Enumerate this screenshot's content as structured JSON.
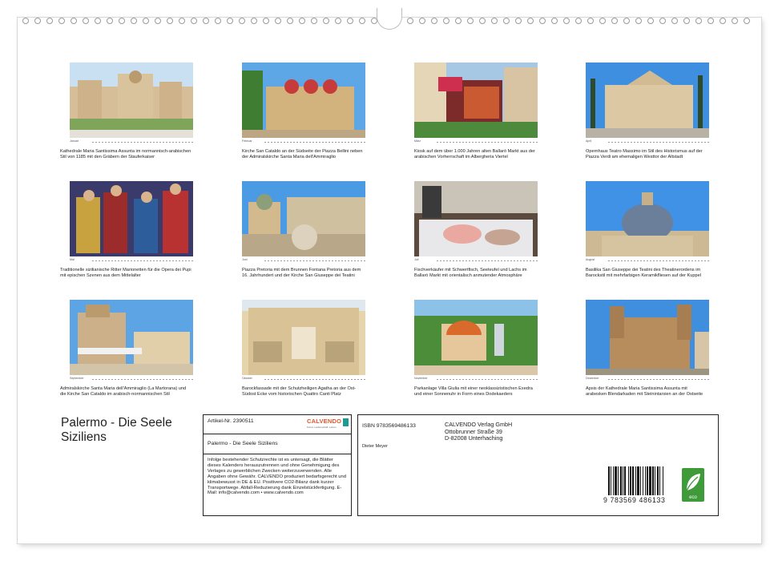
{
  "months": [
    {
      "label": "Januar",
      "caption": "Kathedrale Maria Santissima Assunta im normannisch-arabischen Stil von 1185 mit den Gräbern der Stauferkaiser",
      "scene": "cathedral"
    },
    {
      "label": "Februar",
      "caption": "Kirche San Cataldo an der Südseite der Piazza Bellini neben der Admiralskirche Santa Maria dell'Ammiraglio",
      "scene": "domes"
    },
    {
      "label": "März",
      "caption": "Kiosk auf dem über 1.000 Jahren alten Ballarò Markt aus der arabischen Vorherrschaft im Albergheria Viertel",
      "scene": "kiosk"
    },
    {
      "label": "April",
      "caption": "Opernhaus Teatro Massimo im Stil des Historismus auf der Piazza Verdi am ehemaligen Westtor der Altstadt",
      "scene": "opera"
    },
    {
      "label": "Mai",
      "caption": "Traditionelle sizilianische Ritter Marionetten für die Opera dei Pupi mit epischen Szenen aus dem Mittelalter",
      "scene": "puppets"
    },
    {
      "label": "Juni",
      "caption": "Piazza Pretoria mit dem Brunnen Fontana Pretoria aus dem 16. Jahrhundert und der Kirche San Giuseppe dei Teatini",
      "scene": "fountain"
    },
    {
      "label": "Juli",
      "caption": "Fischverkäufer mit Schwertfisch, Seeteufel und Lachs im Ballarò Markt mit orientalisch anmutender Atmosphäre",
      "scene": "fish"
    },
    {
      "label": "August",
      "caption": "Basilika San Giuseppe dei Teatini des Theatinerordens im Barockstil mit mehrfarbigen Keramikfliesen auf der Kuppel",
      "scene": "basilica"
    },
    {
      "label": "September",
      "caption": "Admiralskirche Santa Maria dell'Ammiraglio (La Martorana) und die Kirche San Cataldo im arabisch-normannischen Stil",
      "scene": "martorana"
    },
    {
      "label": "Oktober",
      "caption": "Barockfassade mit der Schutzheiligen Agatha an der Ost-Südost Ecke vom historischen Quattro Canti Platz",
      "scene": "baroque"
    },
    {
      "label": "November",
      "caption": "Parkanlage Villa Giulia mit einer neoklassizistischen Exedra und einer Sonnenuhr in Form eines Dodekaeders",
      "scene": "park"
    },
    {
      "label": "Dezember",
      "caption": "Apsis der Kathedrale Maria Santissima Assunta mit arabesken Blendarkaden mit Steinintarsien an der Ostseite",
      "scene": "apse"
    }
  ],
  "title_line1": "Palermo - Die Seele",
  "title_line2": "Siziliens",
  "article": "Artikel-Nr. 2390511",
  "calvendo_logo": "CALVENDO",
  "calvendo_tag": "Kunst. Leidenschaft. Leben.",
  "product_title": "Palermo - Die Seele Siziliens",
  "legal": "Infolge bestehender Schutzrechte ist es untersagt, die Blätter dieses Kalenders herauszutrennen und ohne Genehmigung des Verlages zu gewerblichen Zwecken weiterzuverwenden. Alle Angaben ohne Gewähr. CALVENDO produziert bedarfsgerecht und klimabewusst in DE & EU. Positivere CO2-Bilanz dank kurzer Transportwege. Abfall-Reduzierung dank Einzelstückfertigung. E-Mail: info@calvendo.com • www.calvendo.com",
  "isbn": "ISBN 9783569486133",
  "publisher": [
    "CALVENDO Verlag GmbH",
    "Ottobrunner Straße 39",
    "D-82008 Unterhaching"
  ],
  "author": "Dieter Meyer",
  "barcode_number": "9 783569 486133",
  "eco_label": "eco"
}
